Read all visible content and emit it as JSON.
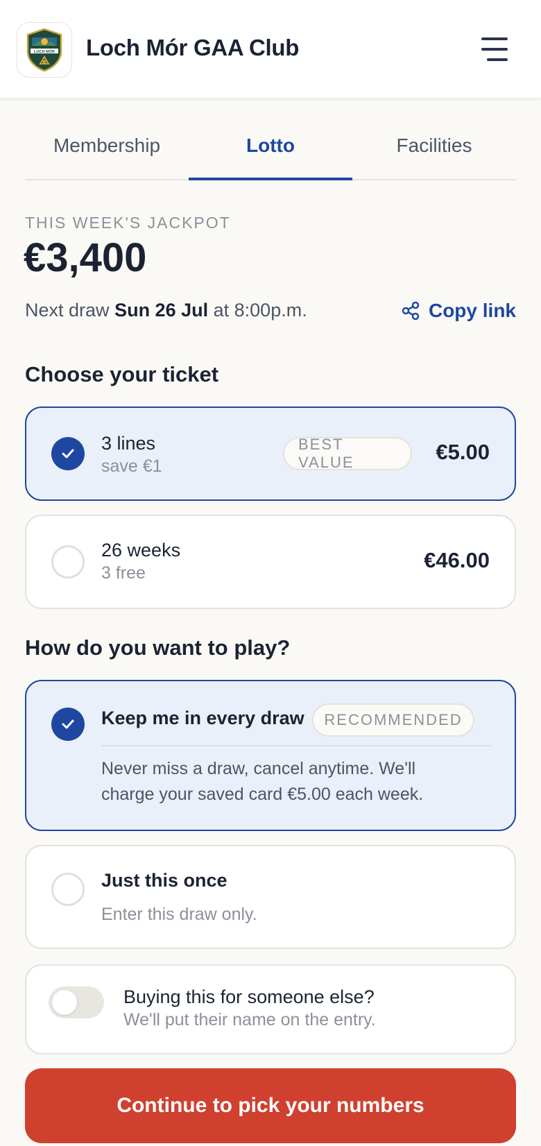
{
  "header": {
    "club_name": "Loch Mór GAA Club",
    "logo_text": "LOCH MÓR"
  },
  "tabs": [
    {
      "label": "Membership",
      "active": false
    },
    {
      "label": "Lotto",
      "active": true
    },
    {
      "label": "Facilities",
      "active": false
    }
  ],
  "jackpot": {
    "label": "THIS WEEK'S JACKPOT",
    "amount": "€3,400",
    "next_draw_prefix": "Next draw",
    "next_draw_date": "Sun 26 Jul",
    "next_draw_suffix": "at 8:00p.m.",
    "copy_link_label": "Copy link"
  },
  "ticket": {
    "title": "Choose your ticket",
    "options": [
      {
        "title": "3 lines",
        "subtitle": "save €1",
        "badge": "BEST VALUE",
        "price": "€5.00",
        "selected": true
      },
      {
        "title": "26 weeks",
        "subtitle": "3 free",
        "badge": "",
        "price": "€46.00",
        "selected": false
      }
    ]
  },
  "play": {
    "title": "How do you want to play?",
    "options": [
      {
        "title": "Keep me in every draw",
        "badge": "RECOMMENDED",
        "description_line1": "Never miss a draw, cancel anytime. We'll",
        "description_line2": "charge your saved card €5.00 each week.",
        "selected": true
      },
      {
        "title": "Just this once",
        "description": "Enter this draw only.",
        "selected": false
      }
    ]
  },
  "gift": {
    "title": "Buying this for someone else?",
    "subtitle": "We'll put their name on the entry.",
    "enabled": false
  },
  "cta": {
    "label": "Continue to pick your numbers"
  },
  "colors": {
    "brand_blue": "#1d47a0",
    "selected_bg": "#eaf0f9",
    "cta_red": "#d0402f",
    "page_bg": "#faf9f6"
  }
}
